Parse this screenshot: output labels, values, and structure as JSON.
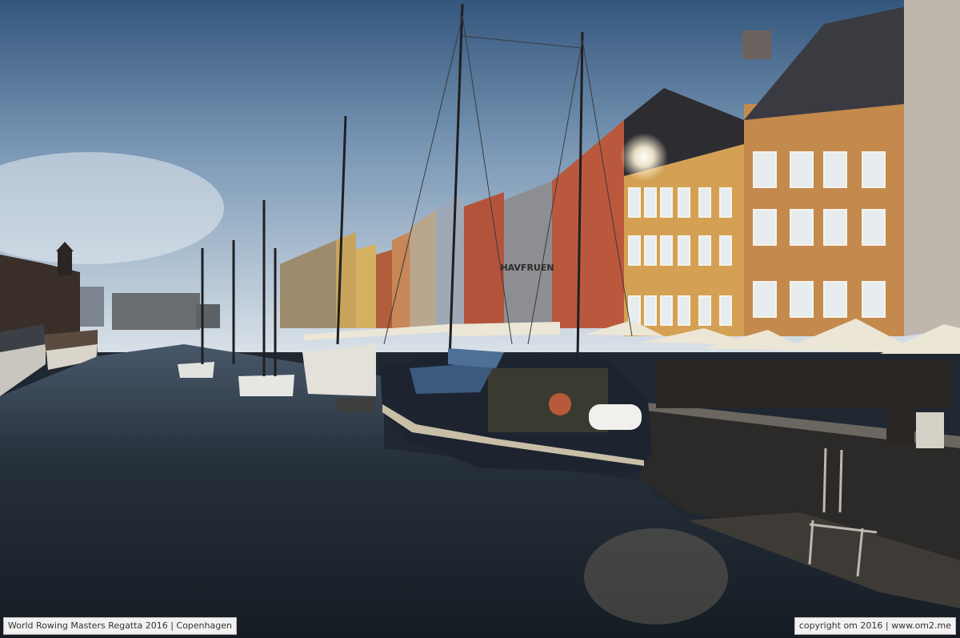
{
  "photo": {
    "caption_left": "World Rowing Masters Regatta 2016 | Copenhagen",
    "caption_right": "copyright om 2016 | www.om2.me",
    "signs": {
      "hav_fruen": "HAVFRUEN"
    },
    "colors": {
      "sky_top": "#3c5f86",
      "sky_bottom": "#c5d3df",
      "water": "#232c36",
      "ochre_building": "#c48a4d",
      "yellow_building": "#d9a85a",
      "red_building": "#b4563a",
      "awning": "#e9e4d6",
      "hull": "#1d2430"
    }
  }
}
